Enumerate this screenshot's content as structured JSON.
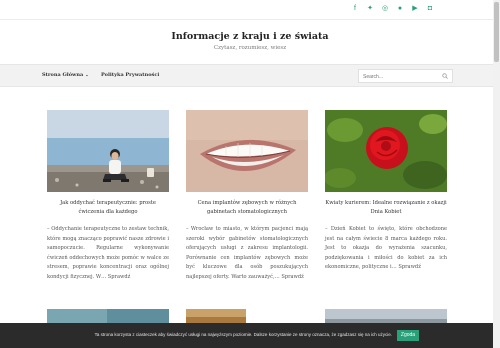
{
  "header": {
    "site_title": "Informacje z kraju i ze świata",
    "tagline": "Czytasz, rozumiesz, wiesz",
    "social_icons": [
      "facebook-icon",
      "twitter-icon",
      "whatsapp-icon",
      "pinterest-icon",
      "youtube-icon",
      "instagram-icon"
    ],
    "accent_color": "#2aa07a"
  },
  "nav": {
    "items": [
      {
        "label": "Strona Główna",
        "has_dropdown": true
      },
      {
        "label": "Polityka Prywatności",
        "has_dropdown": false
      }
    ],
    "caret": "⌄",
    "search_placeholder": "Search..."
  },
  "posts": [
    {
      "title": "Jak oddychać terapeutycznie: proste ćwiczenia dla każdego",
      "excerpt": "– Oddychanie terapeutyczne to zestaw technik, które mogą znacząco poprawić nasze zdrowie i samopoczucie. Regularne wykonywanie ćwiczeń oddechowych może pomóc w walce ze stresem, poprawie koncentracji oraz ogólnej kondycji fizycznej. W… Sprawdź",
      "image": "man-on-beach-photo"
    },
    {
      "title": "Cena implantów zębowych w różnych gabinetach stomatologicznych",
      "excerpt": "– Wrocław to miasto, w którym pacjenci mają szeroki wybór gabinetów stomatologicznych oferujących usługi z zakresu implantologii. Porównanie cen implantów zębowych może być kluczowe dla osób poszukujących najlepszej oferty. Warto zauważyć,… Sprawdź",
      "image": "smile-teeth-photo"
    },
    {
      "title": "Kwiaty kurierem: Idealne rozwiązanie z okazji Dnia Kobiet",
      "excerpt": "– Dzień Kobiet to święto, które obchodzone jest na całym świecie 8 marca każdego roku. Jest to okazja do wyrażenia szacunku, podziękowania i miłości do kobiet za ich ekonomiczne, polityczne i… Sprawdź",
      "image": "red-rose-photo"
    }
  ],
  "cookie": {
    "message": "Ta strona korzysta z ciasteczek aby świadczyć usługi na najwyższym poziomie. Dalsze korzystanie ze strony oznacza, że zgadzasz się na ich użycie.",
    "button_label": "Zgoda"
  }
}
